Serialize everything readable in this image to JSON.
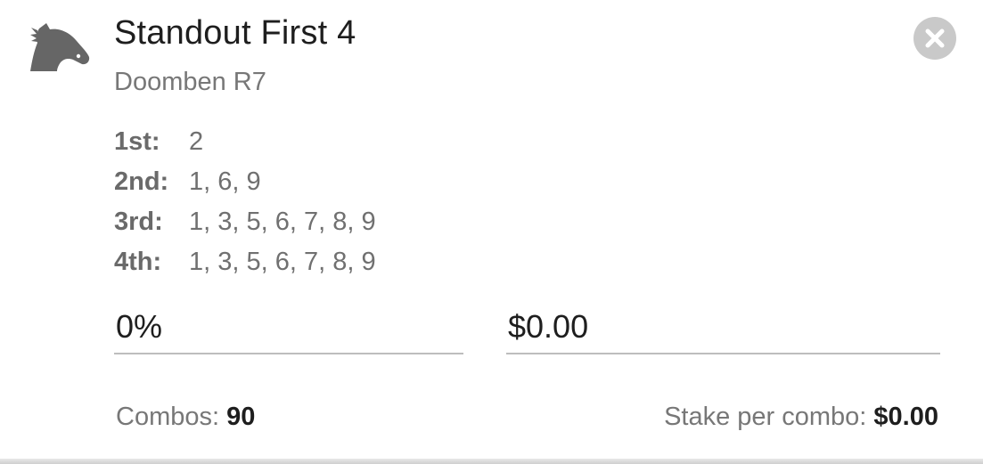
{
  "bet": {
    "icon": "horse-head-icon",
    "title": "Standout First 4",
    "race": "Doomben R7"
  },
  "close": {
    "icon": "close-icon"
  },
  "selections": [
    {
      "label": "1st:",
      "value": "2"
    },
    {
      "label": "2nd:",
      "value": "1, 6, 9"
    },
    {
      "label": "3rd:",
      "value": "1, 3, 5, 6, 7, 8, 9"
    },
    {
      "label": "4th:",
      "value": "1, 3, 5, 6, 7, 8, 9"
    }
  ],
  "inputs": {
    "percent_value": "0%",
    "amount_value": "$0.00"
  },
  "footer": {
    "combos_label": "Combos: ",
    "combos_value": "90",
    "stake_label": "Stake per combo: ",
    "stake_value": "$0.00"
  },
  "colors": {
    "icon_gray": "#666666",
    "close_bg": "#c9c9c9",
    "text_dark": "#1e1e1e",
    "text_muted": "#777777",
    "underline": "#bdbdbd"
  }
}
